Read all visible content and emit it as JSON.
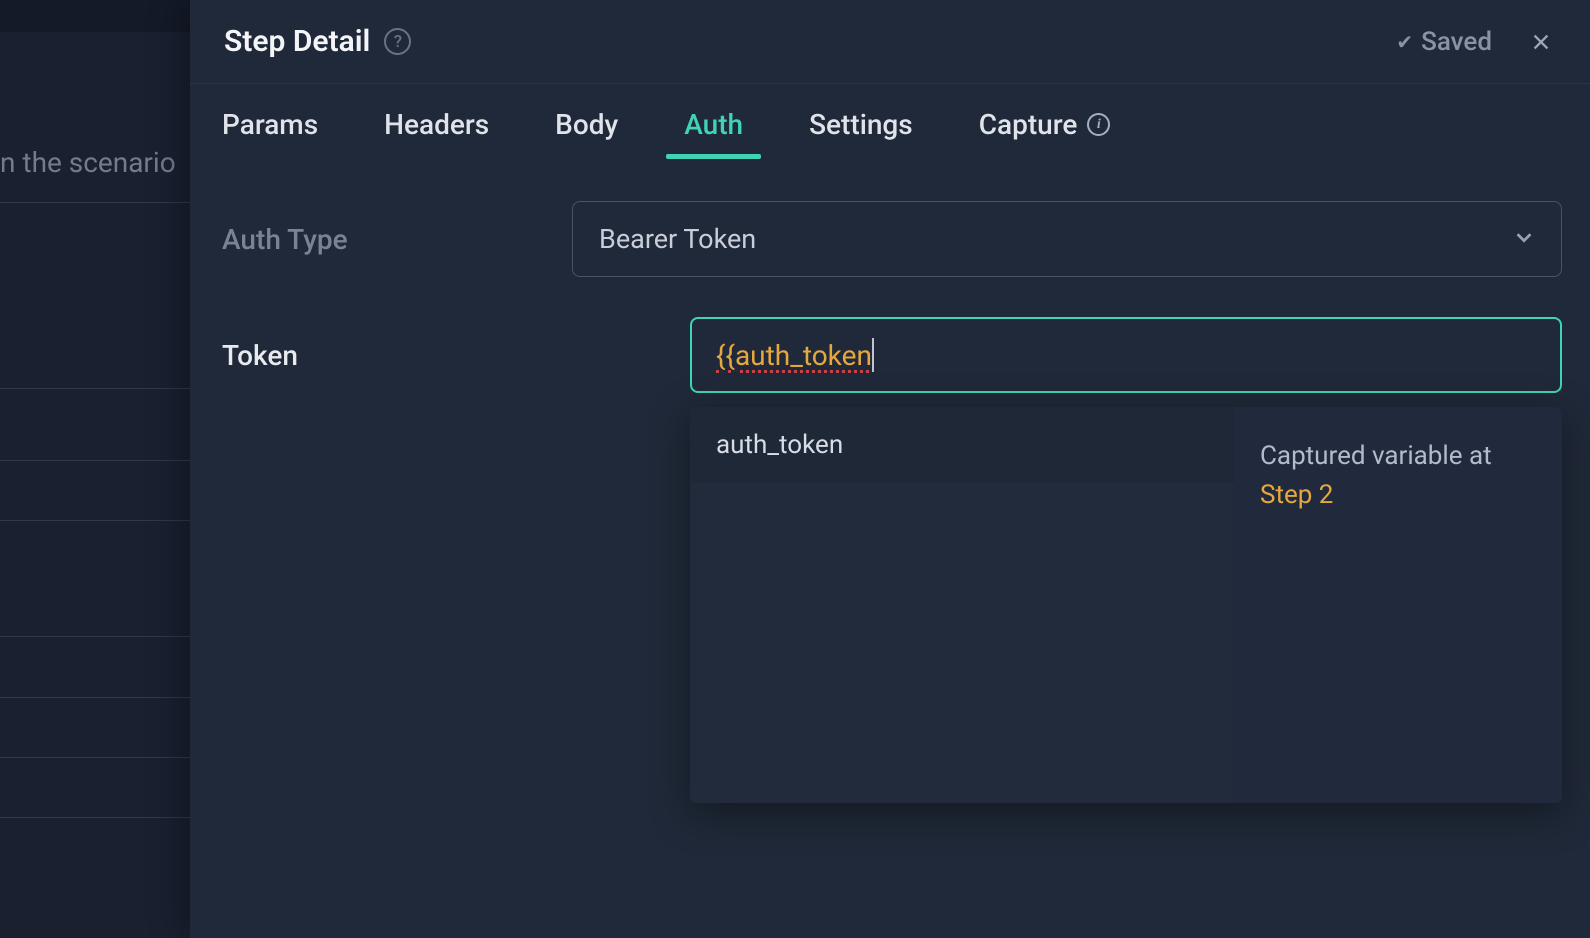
{
  "bg": {
    "text": "n the scenario"
  },
  "header": {
    "title": "Step Detail",
    "saved_label": "Saved"
  },
  "tabs": {
    "params": "Params",
    "headers": "Headers",
    "body": "Body",
    "auth": "Auth",
    "settings": "Settings",
    "capture": "Capture"
  },
  "form": {
    "auth_type_label": "Auth Type",
    "auth_type_value": "Bearer Token",
    "token_label": "Token",
    "token_value": "{{auth_token"
  },
  "dropdown": {
    "item": "auth_token",
    "captured_label": "Captured variable at",
    "step_link": "Step 2"
  }
}
